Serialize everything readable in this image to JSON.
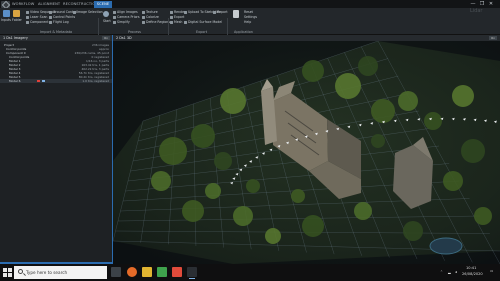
{
  "app": {
    "tabs": [
      "WORKFLOW",
      "ALIGNMENT",
      "RECONSTRUCTION",
      "SCENE"
    ],
    "active_tab": "SCENE",
    "window_controls": [
      "—",
      "❐",
      "✕"
    ],
    "watermark": "Lidar"
  },
  "ribbon": {
    "col1": [
      "Inputs",
      "Folder"
    ],
    "col2": [
      "Video Sequence",
      "Laser Scan",
      "Component"
    ],
    "col3": [
      "Ground Control",
      "Control Points",
      "Flight Log"
    ],
    "col4": [
      "Image Selection"
    ],
    "start_label": "Start",
    "col5": [
      "Align Images",
      "Camera Priors",
      "Simplify"
    ],
    "col6": [
      "Texture",
      "Colorize",
      "Define Regions"
    ],
    "col7": [
      "Render",
      "Export",
      "Mesh"
    ],
    "col8": [
      "Upload To Sketchfab",
      "Digital Surface Model"
    ],
    "col9": [
      "Report"
    ],
    "col10": [
      "Reset",
      "Settings",
      "Help"
    ],
    "groups": [
      "Import & Metadata",
      "Process",
      "Export",
      "Application"
    ]
  },
  "left_panel": {
    "title": "1 Ds1 Imagery",
    "header_button": "On",
    "rows": [
      {
        "label": "Project",
        "value": "236 images"
      },
      {
        "label": "Control points",
        "value": "approx"
      },
      {
        "label": "Component 0",
        "value": "236/236 cams, 45 point"
      },
      {
        "label": "Control points",
        "value": "0 registered"
      },
      {
        "label": "Model 1",
        "value": "1/16 no, 3 parts"
      },
      {
        "label": "Model 2",
        "value": "163.4k tris, 1 parts"
      },
      {
        "label": "Model 3",
        "value": "402.2k tris, 3 parts"
      },
      {
        "label": "Model 4",
        "value": "56.7k tris, registered"
      },
      {
        "label": "Model 5",
        "value": "80.2k tris, registered"
      },
      {
        "label": "Model 6",
        "value": "1.0 tris, registered"
      }
    ],
    "selected_row": 9,
    "swatch_color": "#e0413a"
  },
  "viewport": {
    "title": "2 Ds1 3D",
    "close_label": "On",
    "camera_count": 44
  },
  "taskbar": {
    "search_placeholder": "Type here to search",
    "time": "10:41",
    "date": "26/08/2020",
    "apps": [
      "task-view",
      "firefox",
      "file-explorer",
      "maps",
      "store",
      "reality-capture",
      "photos",
      "app"
    ]
  },
  "colors": {
    "accent": "#2b6cb0",
    "grid": "#7f93a6",
    "foliage": "#3e5a22",
    "cameras": "#e9ecee"
  }
}
